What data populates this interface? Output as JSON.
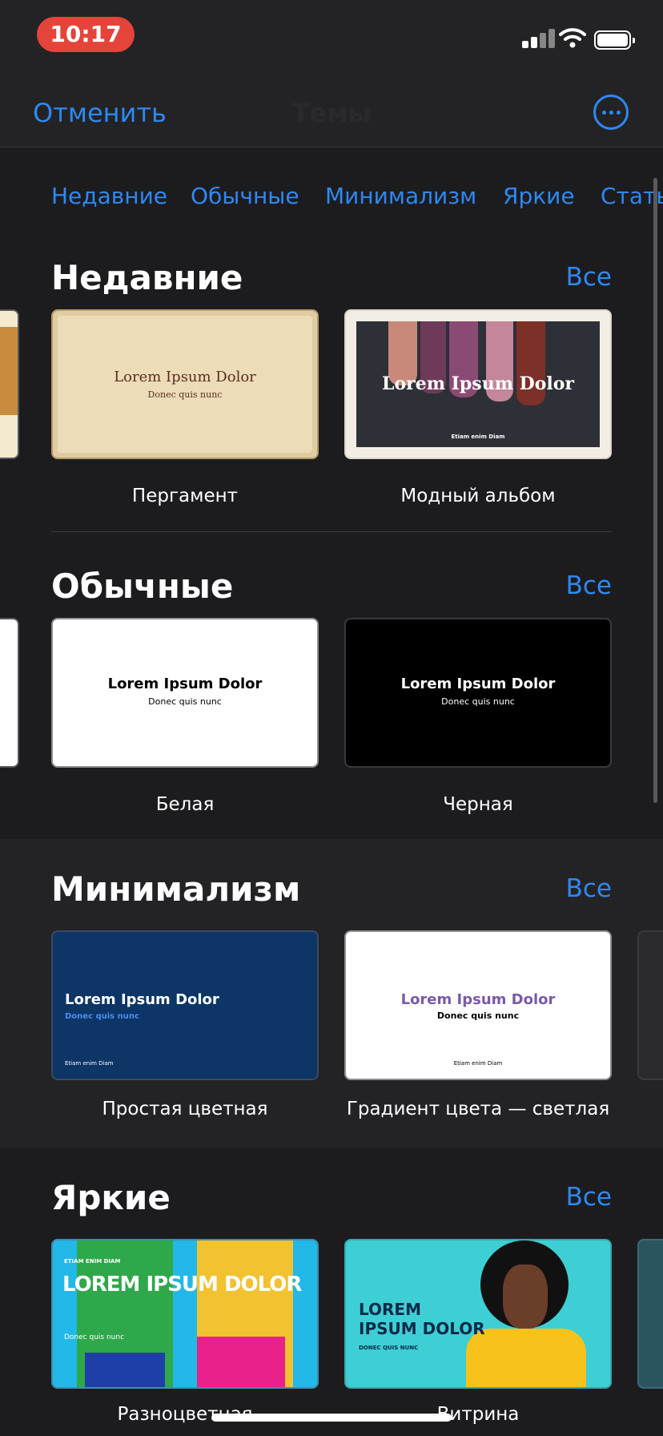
{
  "status_bar": {
    "time": "10:17"
  },
  "navbar": {
    "cancel": "Отменить",
    "title": "Темы"
  },
  "tabs": [
    "Недавние",
    "Обычные",
    "Минимализм",
    "Яркие",
    "Стать"
  ],
  "sections": [
    {
      "title": "Недавние",
      "see_all": "Все",
      "cards": [
        {
          "label": "Пергамент",
          "thumb_title": "Lorem Ipsum Dolor",
          "thumb_sub": "Donec quis nunc"
        },
        {
          "label": "Модный альбом",
          "thumb_title": "Lorem Ipsum Dolor",
          "thumb_sub": "Etiam enim Diam"
        }
      ]
    },
    {
      "title": "Обычные",
      "see_all": "Все",
      "cards": [
        {
          "label": "Белая",
          "thumb_title": "Lorem Ipsum Dolor",
          "thumb_sub": "Donec quis nunc"
        },
        {
          "label": "Черная",
          "thumb_title": "Lorem Ipsum Dolor",
          "thumb_sub": "Donec quis nunc"
        }
      ]
    },
    {
      "title": "Минимализм",
      "see_all": "Все",
      "cards": [
        {
          "label": "Простая цветная",
          "thumb_title": "Lorem Ipsum Dolor",
          "thumb_sub": "Donec quis nunc",
          "thumb_foot": "Etiam enim Diam"
        },
        {
          "label": "Градиент цвета — светлая",
          "thumb_title": "Lorem Ipsum Dolor",
          "thumb_sub": "Donec quis nunc",
          "thumb_foot": "Etiam enim Diam"
        }
      ]
    },
    {
      "title": "Яркие",
      "see_all": "Все",
      "cards": [
        {
          "label": "Разноцветная",
          "thumb_kicker": "ETIAM ENIM DIAM",
          "thumb_title": "LOREM IPSUM DOLOR",
          "thumb_sub": "Donec quis nunc"
        },
        {
          "label": "Витрина",
          "thumb_title_1": "LOREM",
          "thumb_title_2": "IPSUM DOLOR",
          "thumb_sub": "DONEC QUIS NUNC"
        }
      ]
    }
  ],
  "colors": {
    "accent": "#2e88f2",
    "background": "#1c1c1e",
    "section_alt": "#232325",
    "time_pill": "#e5443a"
  }
}
